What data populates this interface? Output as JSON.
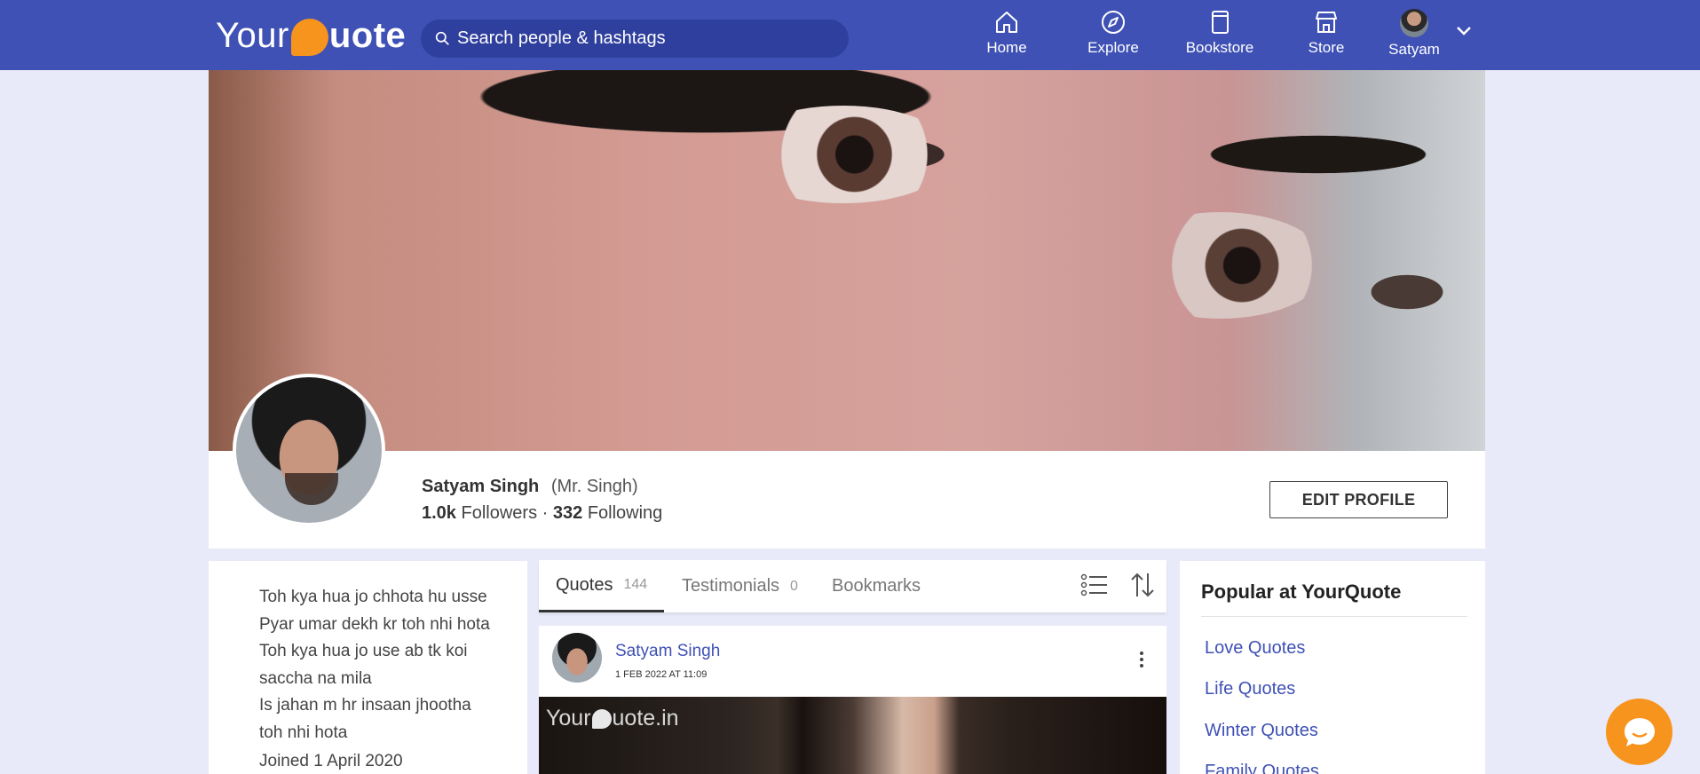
{
  "header": {
    "logo": {
      "your": "Your",
      "quote": "uote"
    },
    "search": {
      "placeholder": "Search people & hashtags"
    },
    "nav": [
      {
        "label": "Home",
        "icon": "home-icon"
      },
      {
        "label": "Explore",
        "icon": "compass-icon"
      },
      {
        "label": "Bookstore",
        "icon": "book-icon"
      },
      {
        "label": "Store",
        "icon": "store-icon"
      },
      {
        "label": "Satyam",
        "icon": "avatar"
      }
    ]
  },
  "profile": {
    "name": "Satyam Singh",
    "alias": "(Mr. Singh)",
    "followers_count": "1.0k",
    "followers_label": "Followers",
    "separator": "·",
    "following_count": "332",
    "following_label": "Following",
    "edit_label": "EDIT PROFILE"
  },
  "bio": {
    "text": "Toh kya hua jo chhota hu usse\nPyar umar dekh kr toh nhi hota\nToh kya hua jo use ab tk koi\nsaccha na mila\nIs jahan m hr insaan jhootha\ntoh nhi hota",
    "joined": "Joined 1 April 2020"
  },
  "tabs": [
    {
      "label": "Quotes",
      "count": "144"
    },
    {
      "label": "Testimonials",
      "count": "0"
    },
    {
      "label": "Bookmarks",
      "count": ""
    }
  ],
  "post": {
    "author": "Satyam Singh",
    "date": "1 FEB 2022 AT 11:09",
    "watermark_your": "Your",
    "watermark_quote": "uote.in"
  },
  "popular": {
    "title": "Popular at YourQuote",
    "items": [
      "Love Quotes",
      "Life Quotes",
      "Winter Quotes",
      "Family Quotes"
    ]
  },
  "colors": {
    "brand": "#3f51b5",
    "accent": "#f7941d",
    "background": "#e8eaf9"
  }
}
